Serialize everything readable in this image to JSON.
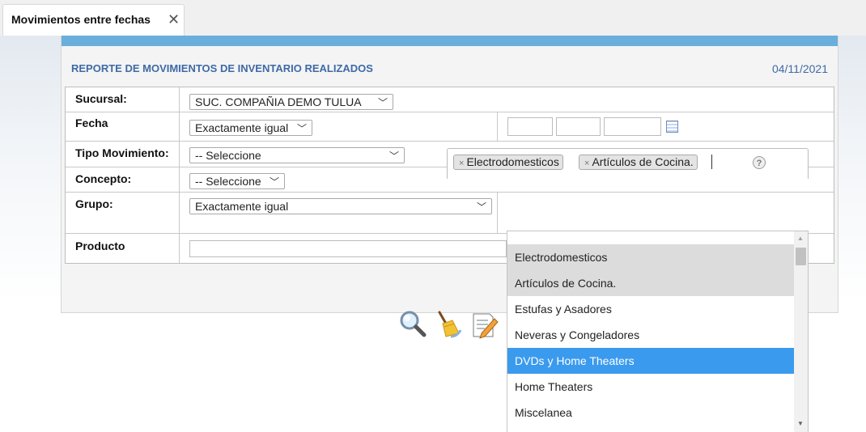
{
  "tab": {
    "title": "Movimientos entre fechas",
    "close": "✕"
  },
  "panel": {
    "title": "REPORTE DE MOVIMIENTOS DE INVENTARIO REALIZADOS",
    "date": "04/11/2021"
  },
  "form": {
    "sucursal": {
      "label": "Sucursal:",
      "value": "SUC. COMPAÑIA DEMO TULUA"
    },
    "fecha": {
      "label": "Fecha",
      "operator": "Exactamente igual"
    },
    "tipo_movimiento": {
      "label": "Tipo Movimiento:",
      "value": "-- Seleccione"
    },
    "concepto": {
      "label": "Concepto:",
      "value": "-- Seleccione"
    },
    "grupo": {
      "label": "Grupo:",
      "operator": "Exactamente igual",
      "selected_tags": [
        "Electrodomesticos",
        "Artículos de Cocina."
      ],
      "tag_remove": "×",
      "help": "?"
    },
    "producto": {
      "label": "Producto",
      "value": ""
    }
  },
  "dropdown": {
    "items": [
      {
        "label": "Electrodomesticos",
        "state": "selected"
      },
      {
        "label": "Artículos de Cocina.",
        "state": "selected"
      },
      {
        "label": "Estufas y Asadores",
        "state": "normal"
      },
      {
        "label": "Neveras y Congeladores",
        "state": "normal"
      },
      {
        "label": "DVDs y Home Theaters",
        "state": "highlighted"
      },
      {
        "label": "Home Theaters",
        "state": "normal"
      },
      {
        "label": "Miscelanea",
        "state": "normal"
      }
    ],
    "scroll_up": "▲",
    "scroll_down": "▼"
  },
  "toolbar": {
    "icons": [
      "search-icon",
      "clear-broom-icon",
      "report-edit-icon"
    ]
  },
  "colors": {
    "header_bar": "#6aaedb",
    "title": "#3e6aa6",
    "highlight": "#3a9aee",
    "selected": "#dcdcdc"
  }
}
